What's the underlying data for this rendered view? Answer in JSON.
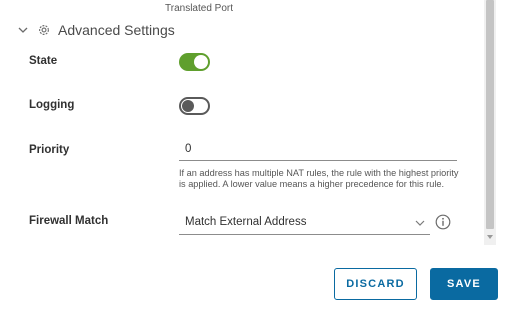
{
  "caption": "Translated Port",
  "section": {
    "title": "Advanced Settings"
  },
  "fields": {
    "state": {
      "label": "State",
      "on": true
    },
    "logging": {
      "label": "Logging",
      "on": false
    },
    "priority": {
      "label": "Priority",
      "value": "0",
      "help": "If an address has multiple NAT rules, the rule with the highest priority is applied. A lower value means a higher precedence for this rule."
    },
    "firewall_match": {
      "label": "Firewall Match",
      "value": "Match External Address"
    }
  },
  "buttons": {
    "discard": "DISCARD",
    "save": "SAVE"
  },
  "colors": {
    "accent": "#0a6aa1",
    "toggle_on": "#5f9f2d"
  }
}
